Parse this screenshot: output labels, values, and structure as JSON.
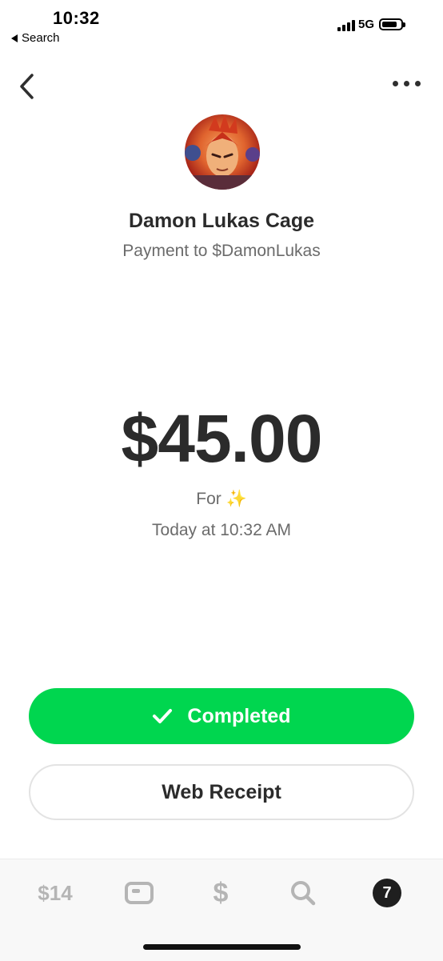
{
  "status_bar": {
    "time": "10:32",
    "back_label": "Search",
    "network": "5G"
  },
  "header": {
    "back_icon": "chevron-left-icon",
    "more_icon": "more-dots-icon"
  },
  "recipient": {
    "name": "Damon Lukas Cage",
    "subtitle": "Payment to $DamonLukas"
  },
  "payment": {
    "amount": "$45.00",
    "note": "For ✨",
    "date": "Today at 10:32 AM"
  },
  "buttons": {
    "completed_label": "Completed",
    "receipt_label": "Web Receipt"
  },
  "tab_bar": {
    "balance": "$14",
    "pay_symbol": "$",
    "activity_count": "7"
  },
  "colors": {
    "accent_green": "#00d64f",
    "text_primary": "#2b2b2b",
    "text_secondary": "#6b6b6b",
    "tab_inactive": "#b5b5b5"
  }
}
